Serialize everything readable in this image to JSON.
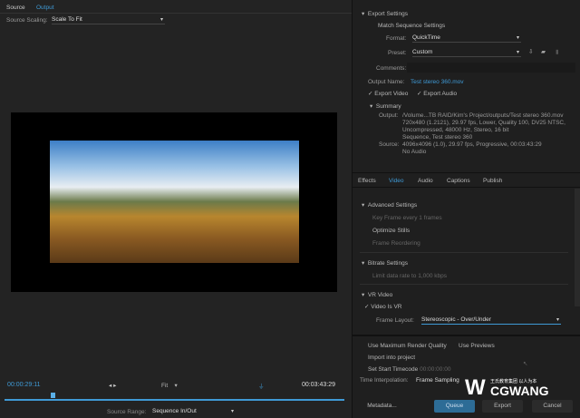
{
  "left": {
    "tabs": [
      "Source",
      "Output"
    ],
    "active_tab": "Output",
    "source_scaling_label": "Source Scaling:",
    "source_scaling_value": "Scale To Fit",
    "timecode_current": "00:00:29:11",
    "timecode_end": "00:03:43:29",
    "fit_label": "Fit",
    "source_range_label": "Source Range:",
    "source_range_value": "Sequence In/Out",
    "playhead_fraction": 0.14
  },
  "export": {
    "section": "Export Settings",
    "match_sequence": "Match Sequence Settings",
    "format_label": "Format:",
    "format_value": "QuickTime",
    "preset_label": "Preset:",
    "preset_value": "Custom",
    "comments_label": "Comments:",
    "output_name_label": "Output Name:",
    "output_name_value": "Test stereo 360.mov",
    "export_video": "Export Video",
    "export_audio": "Export Audio",
    "summary": "Summary",
    "output_label": "Output:",
    "output_lines": [
      "/Volume...TB RAID/Kim's Project/outputs/Test stereo 360.mov",
      "720x480 (1.2121), 29.97 fps, Lower, Quality 100, DV25 NTSC,",
      "Uncompressed, 48000 Hz, Stereo, 16 bit"
    ],
    "source_label": "Source:",
    "source_lines": [
      "Sequence, Test stereo 360",
      "4096x4096 (1.0), 29.97 fps, Progressive, 00:03:43:29",
      "No Audio"
    ]
  },
  "tabs": [
    "Effects",
    "Video",
    "Audio",
    "Captions",
    "Publish"
  ],
  "active_tab": "Video",
  "advanced": {
    "title": "Advanced Settings",
    "keyframe": "Key Frame every  1 frames",
    "optimize": "Optimize Stills",
    "reordering": "Frame Reordering"
  },
  "bitrate": {
    "title": "Bitrate Settings",
    "limit": "Limit data rate to  1,000 kbps"
  },
  "vr": {
    "title": "VR Video",
    "is_vr": "Video Is VR",
    "layout_label": "Frame Layout:",
    "layout_value": "Stereoscopic - Over/Under"
  },
  "bottom": {
    "max_quality": "Use Maximum Render Quality",
    "previews": "Use Previews",
    "import": "Import into project",
    "start_tc": "Set Start Timecode",
    "start_tc_value": "00:00:00:00",
    "interp_label": "Time Interpolation:",
    "interp_value": "Frame Sampling"
  },
  "buttons": {
    "metadata": "Metadata...",
    "queue": "Queue",
    "export": "Export",
    "cancel": "Cancel"
  },
  "watermark": {
    "brand": "CGWANG",
    "tagline": "王氏教育集团 以人为本"
  },
  "colors": {
    "accent": "#3f9ad6",
    "queue": "#2d6c96"
  }
}
